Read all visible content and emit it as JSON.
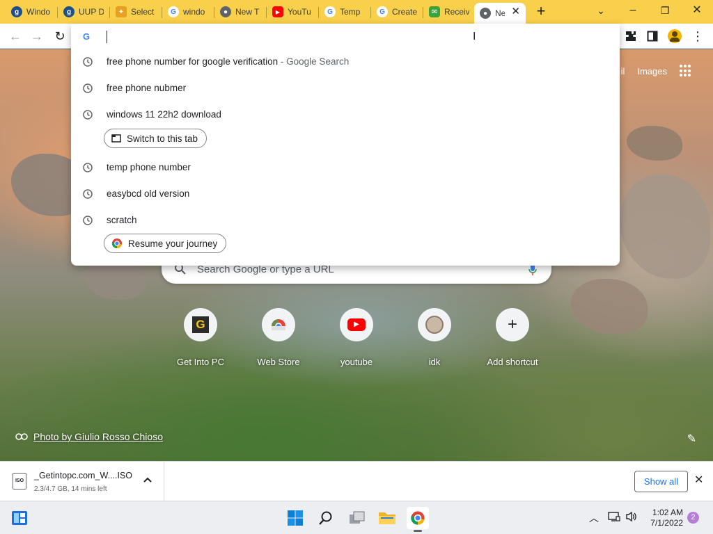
{
  "tabs": [
    {
      "title": "Windo",
      "icon": "g-site-icon",
      "color": "#1f4f8a"
    },
    {
      "title": "UUP D",
      "icon": "g-site-icon",
      "color": "#1f4f8a"
    },
    {
      "title": "Select",
      "icon": "scratch-cat-icon",
      "color": "#e8a020"
    },
    {
      "title": "windo",
      "icon": "google-icon",
      "color": "#4285f4"
    },
    {
      "title": "New T",
      "icon": "chrome-icon",
      "color": "#5f6368"
    },
    {
      "title": "YouTu",
      "icon": "youtube-icon",
      "color": "#ff0000"
    },
    {
      "title": "Temp",
      "icon": "google-icon",
      "color": "#4285f4"
    },
    {
      "title": "Create",
      "icon": "google-icon",
      "color": "#4285f4"
    },
    {
      "title": "Receiv",
      "icon": "sms-icon",
      "color": "#3aa33a"
    },
    {
      "title": "Ne",
      "icon": "chrome-icon",
      "color": "#5f6368",
      "active": true
    }
  ],
  "window": {
    "minimize": "–",
    "maximize": "❐",
    "close": "✕",
    "tab_search": "⌄",
    "new_tab": "+"
  },
  "omnibox": {
    "value": ""
  },
  "suggestions": [
    {
      "text": "free phone number for google verification",
      "sub": " - Google Search",
      "icon": "history-clock-icon"
    },
    {
      "text": "free phone nubmer",
      "sub": "",
      "icon": "history-clock-icon"
    },
    {
      "text": "windows 11 22h2 download",
      "sub": "",
      "icon": "history-clock-icon"
    },
    {
      "text": "temp phone number",
      "sub": "",
      "icon": "history-clock-icon"
    },
    {
      "text": "easybcd old version",
      "sub": "",
      "icon": "history-clock-icon"
    },
    {
      "text": "scratch",
      "sub": "",
      "icon": "history-clock-icon"
    }
  ],
  "chips": {
    "switch_tab": "Switch to this tab",
    "resume_journey": "Resume your journey"
  },
  "ntp": {
    "links": {
      "gmail": "il",
      "images": "Images"
    },
    "search_placeholder": "Search Google or type a URL",
    "shortcuts": [
      {
        "label": "Get Into PC",
        "icon": "getintopc-icon"
      },
      {
        "label": "Web Store",
        "icon": "web-store-icon"
      },
      {
        "label": "youtube",
        "icon": "youtube-icon"
      },
      {
        "label": "idk",
        "icon": "avatar-icon"
      },
      {
        "label": "Add shortcut",
        "icon": "plus-icon"
      }
    ],
    "photo_credit": "Photo by Giulio Rosso Chioso"
  },
  "download": {
    "filename": "_Getintopc.com_W....ISO",
    "status": "2.3/4.7 GB, 14 mins left",
    "file_badge": "ISO",
    "show_all": "Show all"
  },
  "taskbar": {
    "time": "1:02 AM",
    "date": "7/1/2022",
    "notifications": "2"
  },
  "colors": {
    "tabstrip": "#f9d04b",
    "accent": "#1a73e8"
  }
}
